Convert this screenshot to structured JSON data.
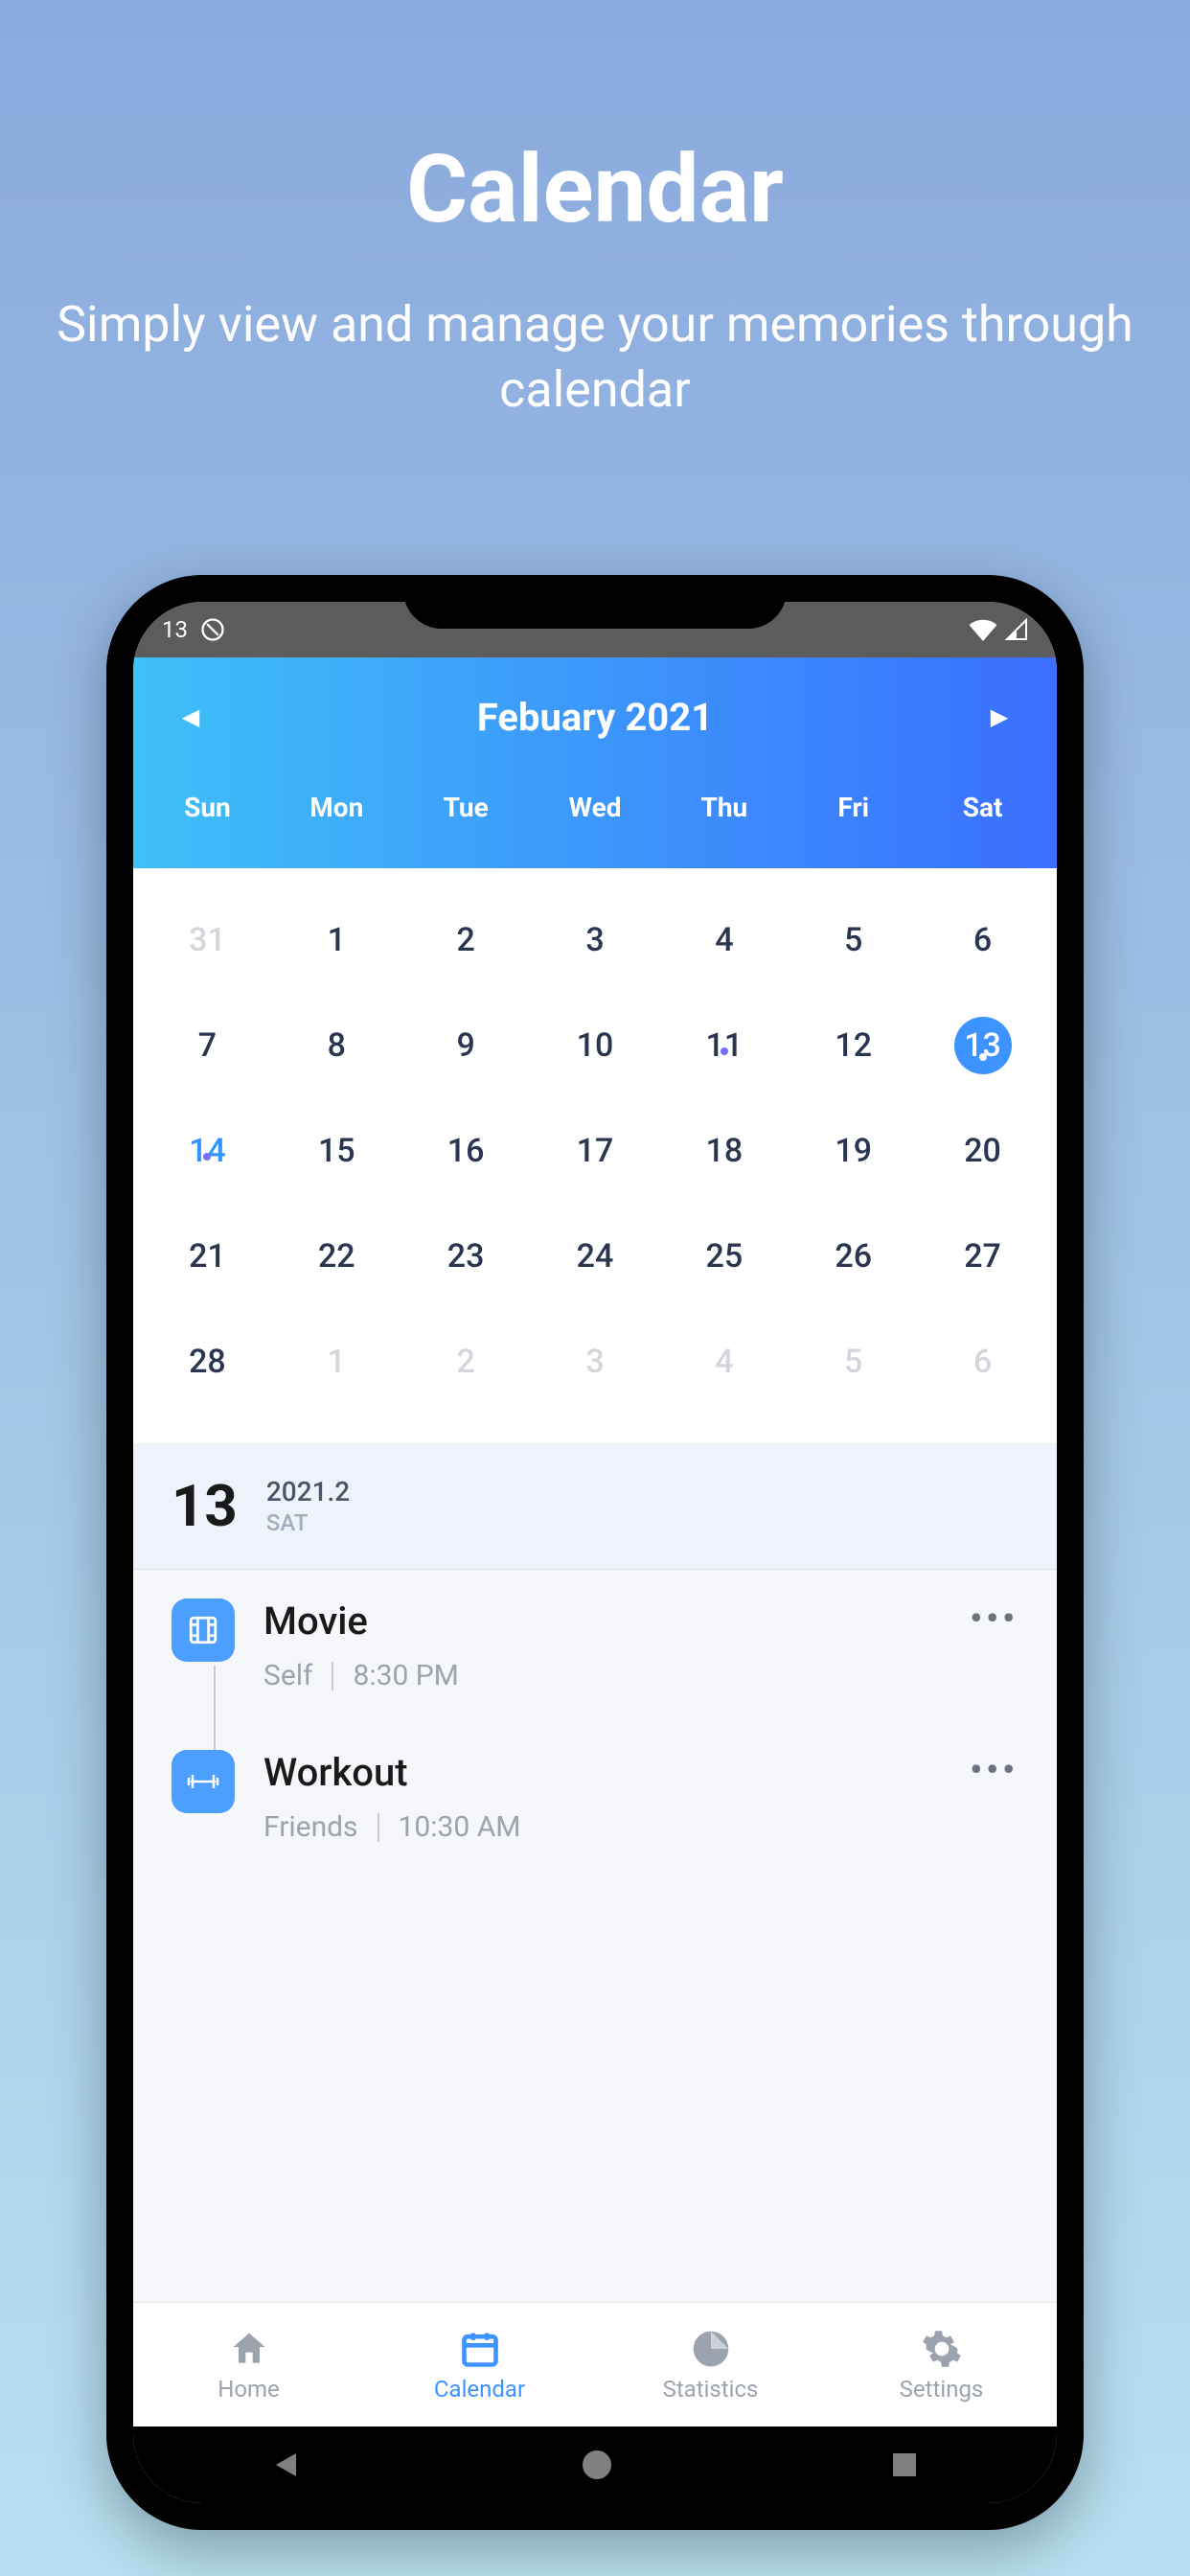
{
  "promo": {
    "title": "Calendar",
    "subtitle": "Simply view and manage your memories through calendar"
  },
  "statusBar": {
    "time": "13"
  },
  "calendar": {
    "monthLabel": "Febuary 2021",
    "weekdays": [
      "Sun",
      "Mon",
      "Tue",
      "Wed",
      "Thu",
      "Fri",
      "Sat"
    ],
    "rows": [
      [
        {
          "n": "31",
          "muted": true
        },
        {
          "n": "1"
        },
        {
          "n": "2"
        },
        {
          "n": "3"
        },
        {
          "n": "4"
        },
        {
          "n": "5"
        },
        {
          "n": "6"
        }
      ],
      [
        {
          "n": "7"
        },
        {
          "n": "8"
        },
        {
          "n": "9"
        },
        {
          "n": "10"
        },
        {
          "n": "11",
          "dot": true
        },
        {
          "n": "12"
        },
        {
          "n": "13",
          "selected": true,
          "dot": true
        }
      ],
      [
        {
          "n": "14",
          "today": true,
          "dot": true
        },
        {
          "n": "15"
        },
        {
          "n": "16"
        },
        {
          "n": "17"
        },
        {
          "n": "18"
        },
        {
          "n": "19"
        },
        {
          "n": "20"
        }
      ],
      [
        {
          "n": "21"
        },
        {
          "n": "22"
        },
        {
          "n": "23"
        },
        {
          "n": "24"
        },
        {
          "n": "25"
        },
        {
          "n": "26"
        },
        {
          "n": "27"
        }
      ],
      [
        {
          "n": "28"
        },
        {
          "n": "1",
          "muted": true
        },
        {
          "n": "2",
          "muted": true
        },
        {
          "n": "3",
          "muted": true
        },
        {
          "n": "4",
          "muted": true
        },
        {
          "n": "5",
          "muted": true
        },
        {
          "n": "6",
          "muted": true
        }
      ]
    ]
  },
  "selectedDay": {
    "num": "13",
    "date": "2021.2",
    "dow": "SAT"
  },
  "events": [
    {
      "title": "Movie",
      "who": "Self",
      "time": "8:30 PM",
      "icon": "film"
    },
    {
      "title": "Workout",
      "who": "Friends",
      "time": "10:30 AM",
      "icon": "dumbbell"
    }
  ],
  "nav": {
    "items": [
      {
        "label": "Home",
        "icon": "home"
      },
      {
        "label": "Calendar",
        "icon": "calendar",
        "active": true
      },
      {
        "label": "Statistics",
        "icon": "stats"
      },
      {
        "label": "Settings",
        "icon": "gear"
      }
    ]
  }
}
